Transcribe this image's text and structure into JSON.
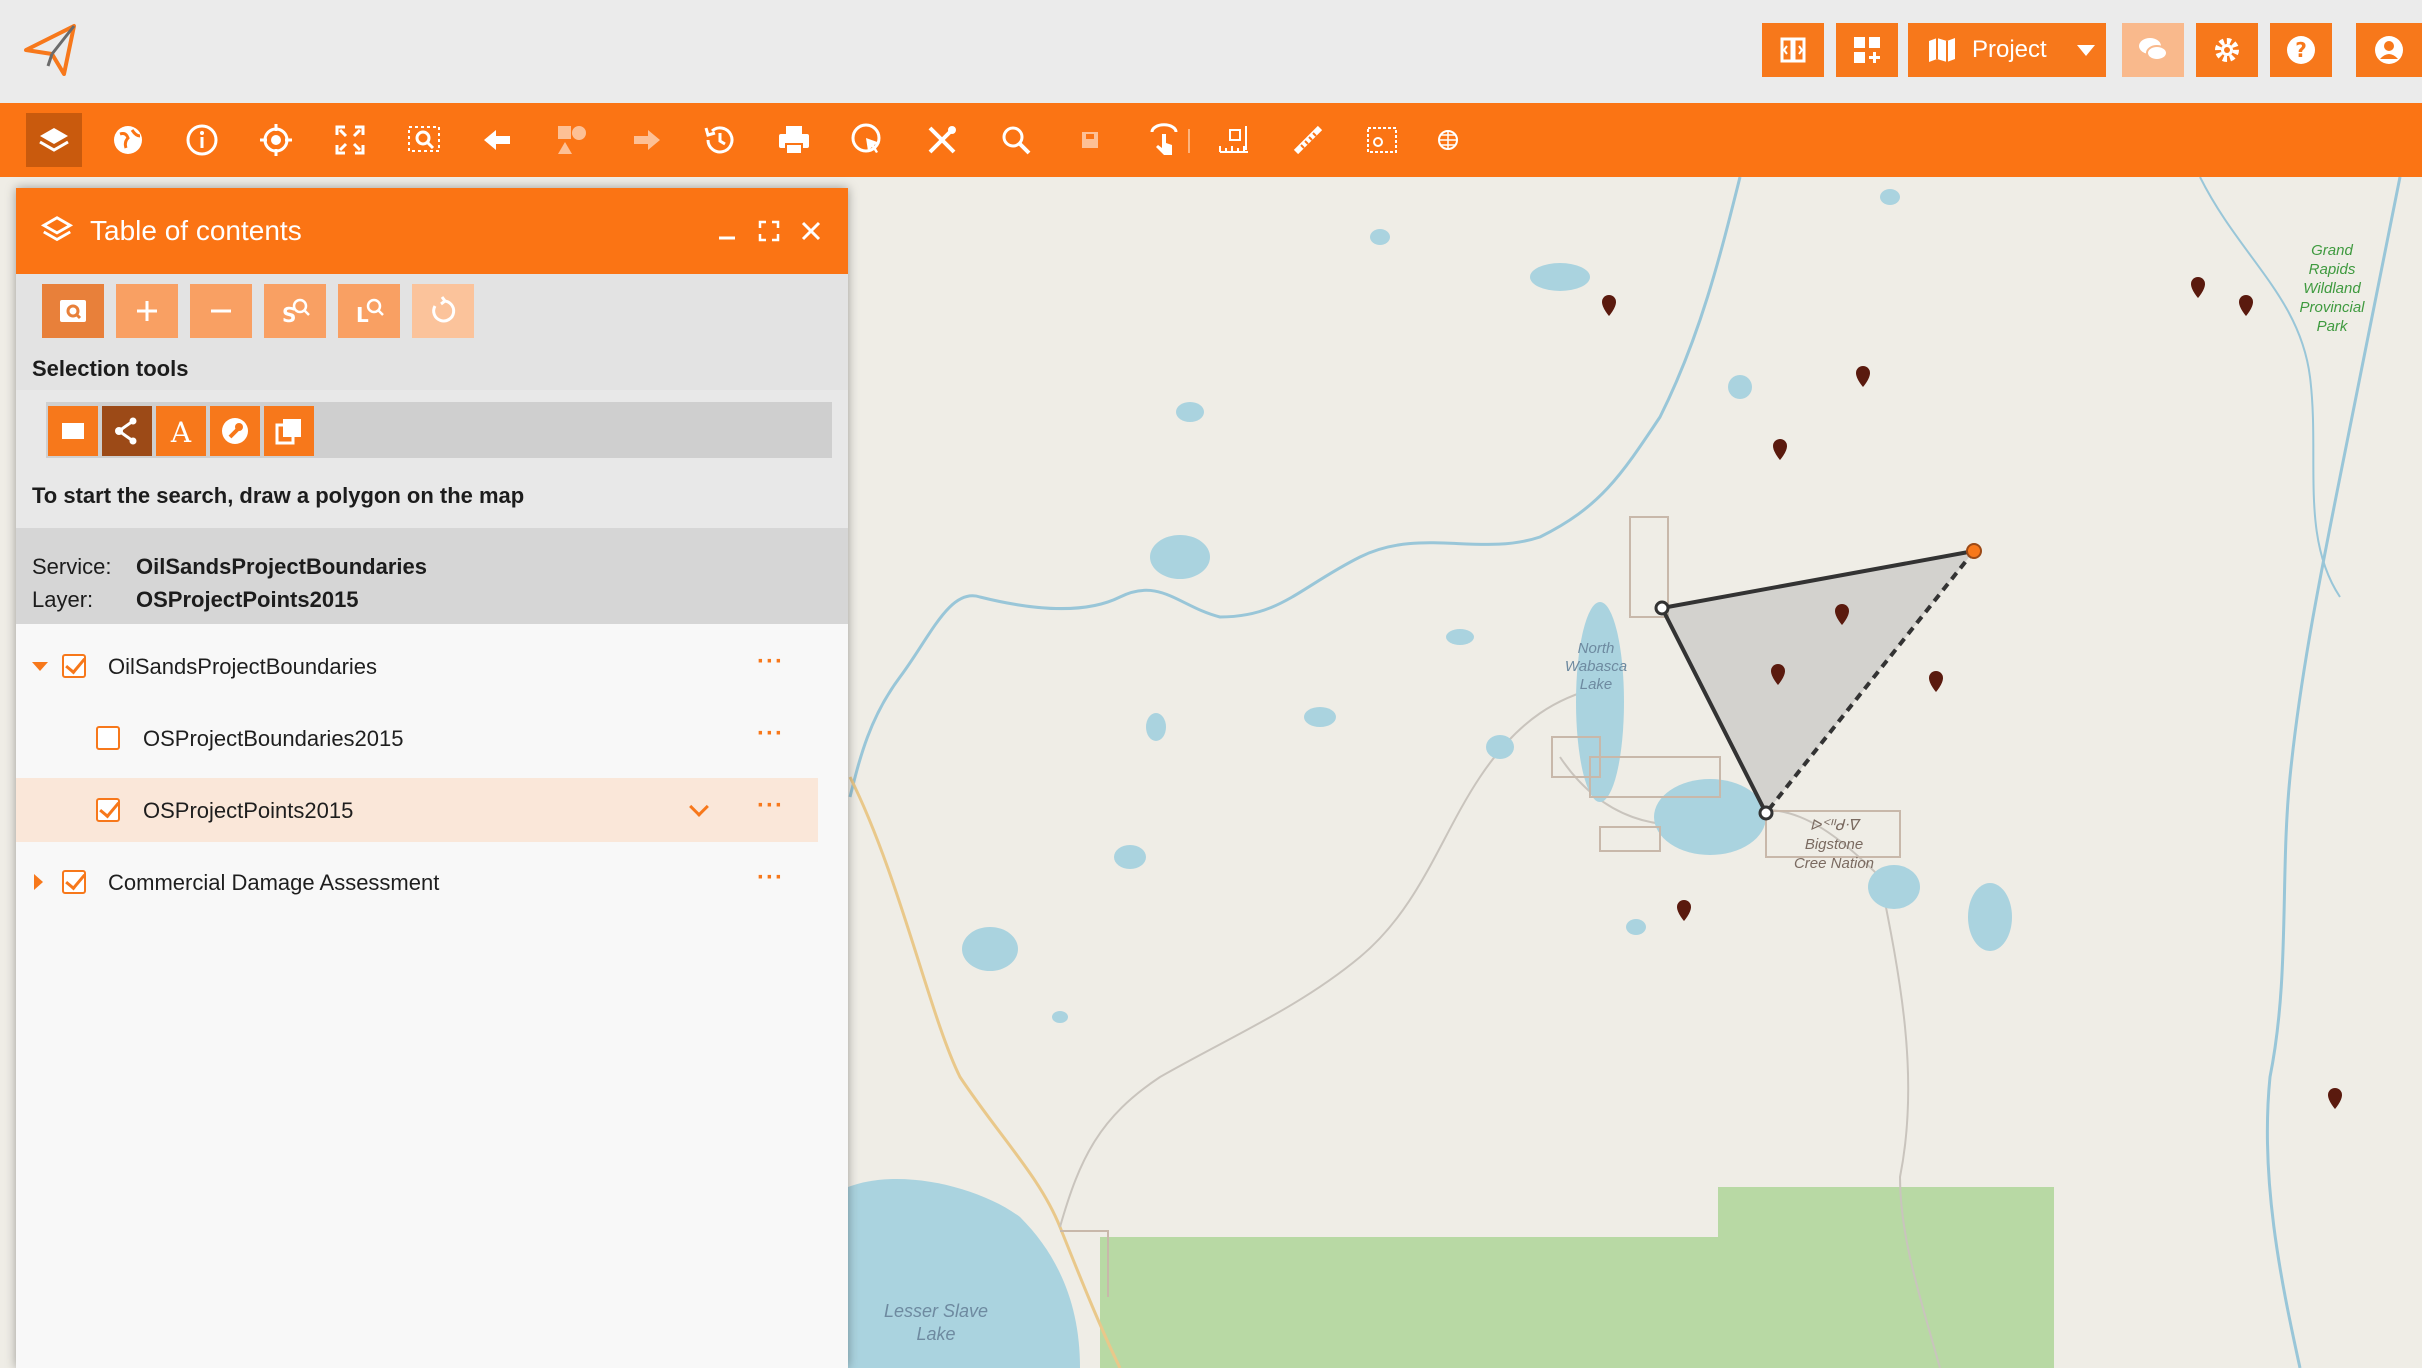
{
  "header": {
    "logo_icon": "paper-plane-logo-icon",
    "buttons": [
      {
        "name": "split-view-icon"
      },
      {
        "name": "add-widget-icon"
      },
      {
        "name": "chat-icon"
      },
      {
        "name": "gear-icon"
      },
      {
        "name": "help-icon"
      },
      {
        "name": "user-icon"
      }
    ],
    "project_label": "Project"
  },
  "toolbar": {
    "tools": [
      "layers-icon",
      "globe-icon",
      "info-icon",
      "locate-icon",
      "fullscreen-icon",
      "zoom-select-icon",
      "back-arrow-icon",
      "shapes-icon",
      "forward-arrow-icon",
      "history-icon",
      "print-icon",
      "select-cursor-icon",
      "tools-icon",
      "search-icon",
      "save-icon",
      "touch-icon",
      "measure-ruler-icon",
      "measure-line-icon",
      "measure-area-icon",
      "globe-grid-icon"
    ]
  },
  "panel": {
    "title": "Table of contents",
    "selection_tools_label": "Selection tools",
    "instruction": "To start the search, draw a polygon on the map",
    "service_key": "Service:",
    "service_value": "OilSandsProjectBoundaries",
    "layer_key": "Layer:",
    "layer_value": "OSProjectPoints2015",
    "tree": [
      {
        "label": "OilSandsProjectBoundaries",
        "checked": true,
        "expanded": true
      },
      {
        "label": "OSProjectBoundaries2015",
        "checked": false
      },
      {
        "label": "OSProjectPoints2015",
        "checked": true,
        "selected": true
      },
      {
        "label": "Commercial Damage Assessment",
        "checked": true,
        "expanded": false
      }
    ],
    "more_label": "···"
  },
  "map": {
    "labels": {
      "north_wabasca": [
        "North",
        "Wabasca",
        "Lake"
      ],
      "bigstone": [
        "ᐅᑉᐦᑯᐧᐁ",
        "Bigstone",
        "Cree Nation"
      ],
      "grand_rapids": [
        "Grand",
        "Rapids",
        "Wildland",
        "Provincial",
        "Park"
      ],
      "lesser_slave": [
        "Lesser Slave",
        "Lake"
      ]
    }
  },
  "colors": {
    "accent": "#fb7414",
    "water": "#aad3df",
    "park": "#b8d9a4",
    "land": "#efede6"
  }
}
